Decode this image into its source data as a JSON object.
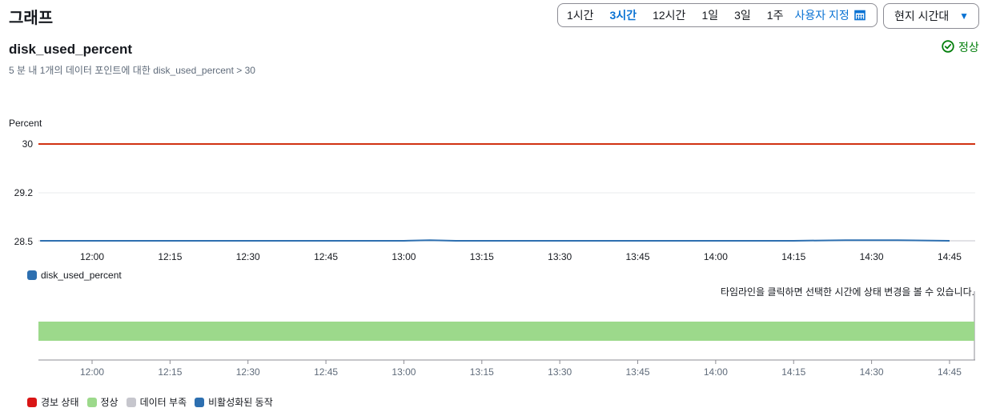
{
  "header": {
    "title": "그래프",
    "ranges": [
      "1시간",
      "3시간",
      "12시간",
      "1일",
      "3일",
      "1주"
    ],
    "active_range": "3시간",
    "custom_label": "사용자 지정",
    "timezone": "현지 시간대"
  },
  "metric": {
    "title": "disk_used_percent",
    "subtitle": "5 분 내 1개의 데이터 포인트에 대한 disk_used_percent > 30",
    "status": "정상"
  },
  "chart_data": {
    "type": "line",
    "ylabel": "Percent",
    "y_ticks": [
      "30",
      "29.2",
      "28.5"
    ],
    "ylim": [
      28.5,
      30
    ],
    "x_ticks": [
      "12:00",
      "12:15",
      "12:30",
      "12:45",
      "13:00",
      "13:15",
      "13:30",
      "13:45",
      "14:00",
      "14:15",
      "14:30",
      "14:45"
    ],
    "threshold": 30,
    "series": [
      {
        "name": "disk_used_percent",
        "color": "#2d6fb0",
        "x": [
          "11:50",
          "12:00",
          "12:15",
          "12:30",
          "12:45",
          "13:00",
          "13:05",
          "13:10",
          "13:15",
          "13:30",
          "13:45",
          "14:00",
          "14:15",
          "14:25",
          "14:30",
          "14:35",
          "14:45"
        ],
        "values": [
          28.5,
          28.5,
          28.5,
          28.5,
          28.5,
          28.5,
          28.51,
          28.5,
          28.5,
          28.5,
          28.5,
          28.5,
          28.5,
          28.51,
          28.51,
          28.51,
          28.5
        ]
      }
    ],
    "threshold_color": "#d13212",
    "grid": true
  },
  "timeline": {
    "hint": "타임라인을 클릭하면 선택한 시간에 상태 변경을 볼 수 있습니다.",
    "state_color": "#9cd98b",
    "x_ticks": [
      "12:00",
      "12:15",
      "12:30",
      "12:45",
      "13:00",
      "13:15",
      "13:30",
      "13:45",
      "14:00",
      "14:15",
      "14:30",
      "14:45"
    ],
    "legend": [
      {
        "label": "경보 상태",
        "color": "#d91515"
      },
      {
        "label": "정상",
        "color": "#9cd98b"
      },
      {
        "label": "데이터 부족",
        "color": "#c6c6cd"
      },
      {
        "label": "비활성화된 동작",
        "color": "#2d6fb0"
      }
    ]
  },
  "icons": {
    "status": "check-circle-icon",
    "calendar": "calendar-icon",
    "caret": "caret-down-icon"
  }
}
